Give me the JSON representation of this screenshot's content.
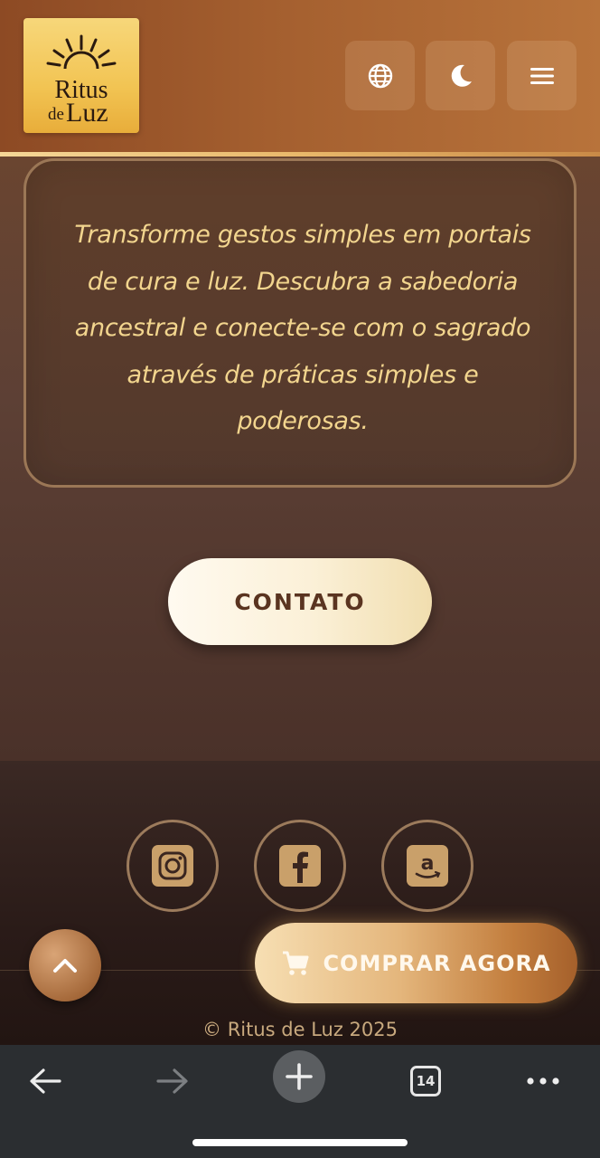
{
  "header": {
    "logo": {
      "line1": "Ritus",
      "line2_small": "de",
      "line2_large": "Luz"
    },
    "buttons": [
      {
        "icon": "globe-icon"
      },
      {
        "icon": "moon-icon"
      },
      {
        "icon": "hamburger-menu-icon"
      }
    ]
  },
  "main": {
    "intro_text": "Transforme gestos simples em portais de cura e luz. Descubra a sabedoria ancestral e conecte-se com o sagrado através de práticas simples e poderosas.",
    "contact_button": "CONTATO"
  },
  "footer": {
    "social": [
      {
        "icon": "instagram-icon"
      },
      {
        "icon": "facebook-icon"
      },
      {
        "icon": "amazon-icon"
      }
    ],
    "copyright": "© Ritus de Luz 2025",
    "buy_button": "COMPRAR AGORA",
    "back_to_top_icon": "chevron-up-icon"
  },
  "browser_bar": {
    "tab_count": "14",
    "icons": [
      "back-arrow-icon",
      "forward-arrow-icon",
      "new-tab-plus-icon",
      "tabs-icon",
      "more-icon"
    ]
  },
  "colors": {
    "accent_gold": "#f2d58e",
    "button_text": "#5a3420",
    "header_brown": "#a45f2f",
    "footer_dark": "#2a1b18"
  }
}
